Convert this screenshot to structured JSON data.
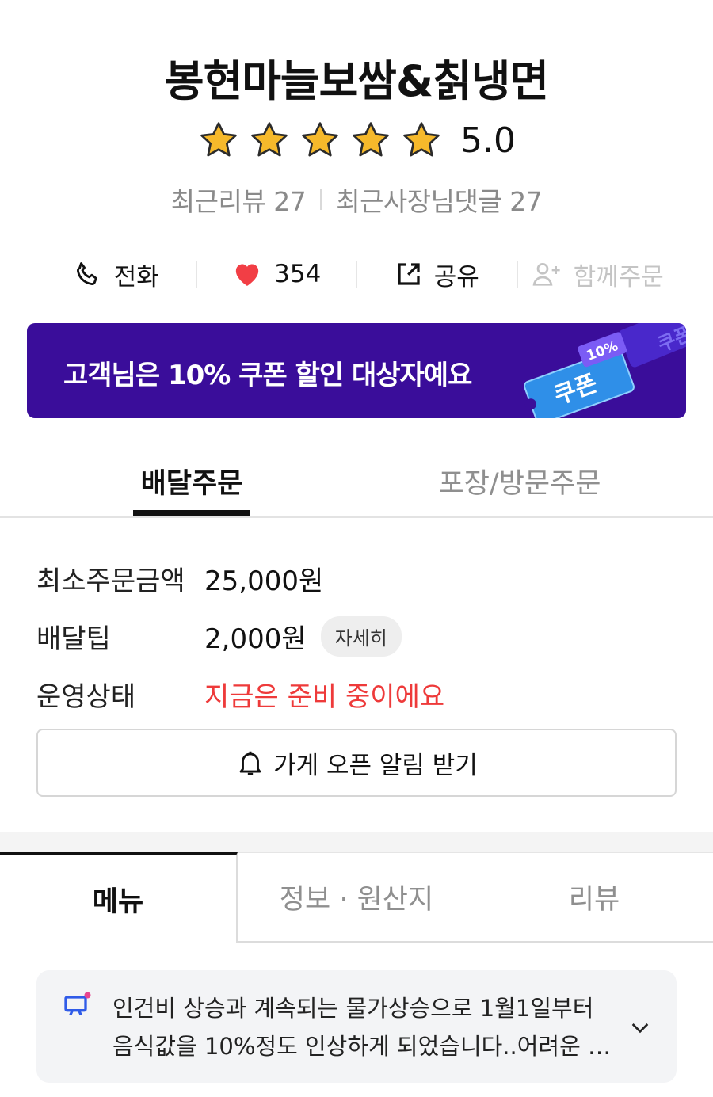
{
  "store": {
    "name": "봉현마늘보쌈&칡냉면",
    "rating": "5.0",
    "stars": 5,
    "recent_reviews": "최근리뷰 27",
    "recent_owner_replies": "최근사장님댓글 27"
  },
  "actions": {
    "call_label": "전화",
    "like_count": "354",
    "share_label": "공유",
    "group_order_label": "함께주문"
  },
  "coupon_banner": {
    "text": "고객님은 10% 쿠폰 할인 대상자예요",
    "ticket_label": "쿠폰",
    "ticket_percent": "10%",
    "bg_color": "#3a0d9a"
  },
  "order_tabs": {
    "delivery": "배달주문",
    "pickup": "포장/방문주문"
  },
  "order_info": {
    "min_order_label": "최소주문금액",
    "min_order_value": "25,000원",
    "delivery_tip_label": "배달팁",
    "delivery_tip_value": "2,000원",
    "detail_label": "자세히",
    "status_label": "운영상태",
    "status_value": "지금은 준비 중이에요",
    "status_color": "#ee3a3a"
  },
  "notify_button": {
    "label": "가게 오픈 알림 받기"
  },
  "menu_tabs": {
    "menu": "메뉴",
    "info": "정보 · 원산지",
    "review": "리뷰"
  },
  "notice": {
    "text": "인건비 상승과 계속되는 물가상승으로 1월1일부터 음식값을 10%정도 인상하게 되었습니다..어려운 상황입니다"
  },
  "icons": {
    "star": "star-icon",
    "phone": "phone-icon",
    "heart": "heart-icon",
    "share": "share-icon",
    "group": "user-plus-icon",
    "bell": "bell-icon",
    "notice": "announcement-icon",
    "chevron": "chevron-down-icon"
  }
}
